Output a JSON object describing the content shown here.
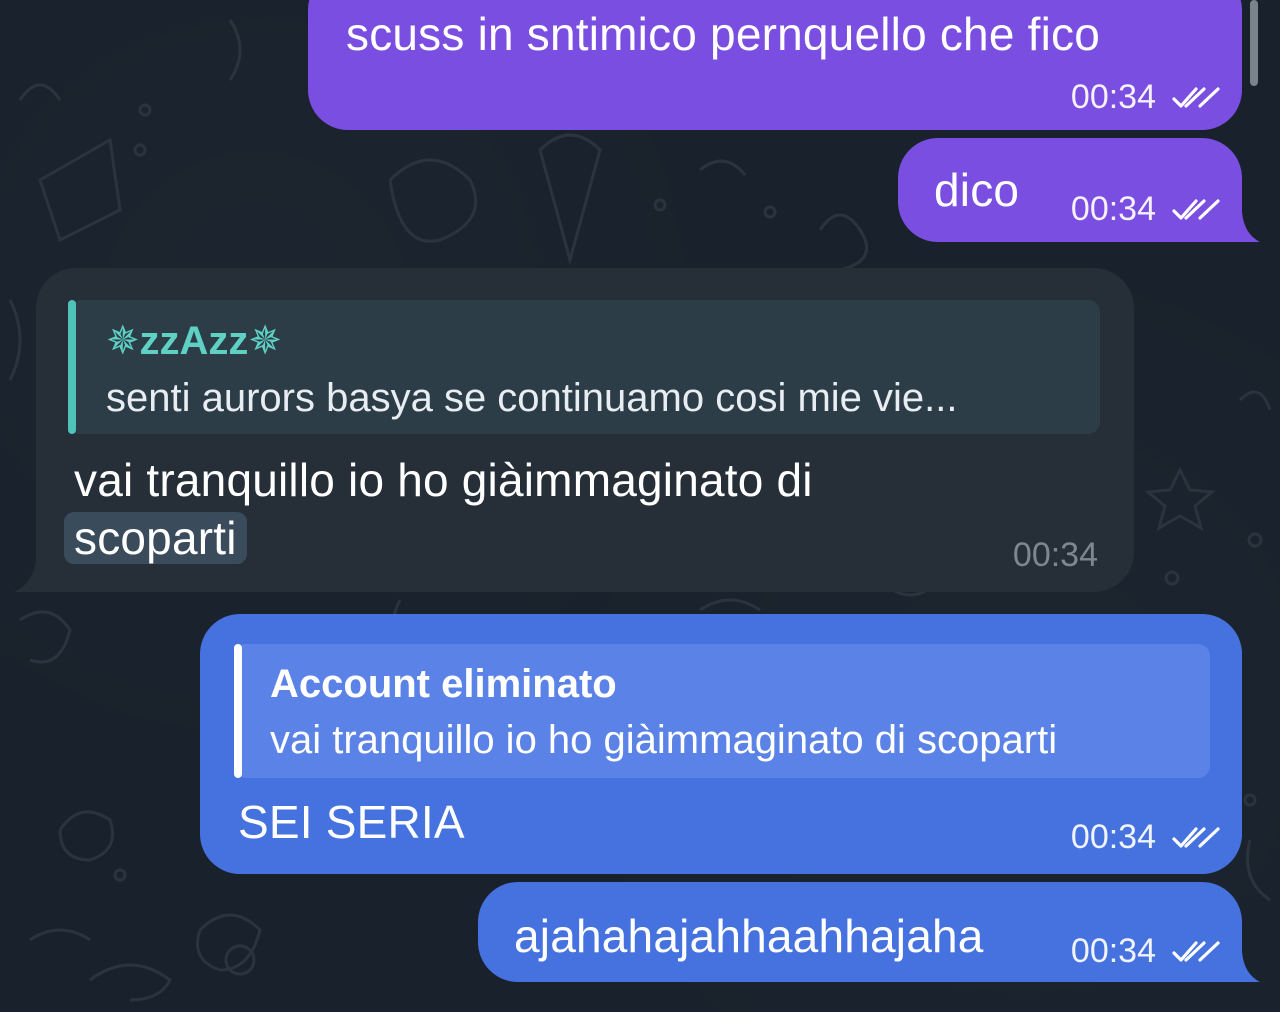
{
  "messages": [
    {
      "text": "scuss in sntimico pernquello che fico",
      "time": "00:34"
    },
    {
      "text": "dico",
      "time": "00:34"
    },
    {
      "reply_name": "✵zzAzz✵",
      "reply_text": "senti aurors basya se continuamo cosi mie vie...",
      "text_line1": "vai tranquillo io ho giàimmaginato di",
      "text_line2": "scoparti",
      "time": "00:34"
    },
    {
      "reply_name": "Account eliminato",
      "reply_text": "vai tranquillo io ho giàimmaginato di scoparti",
      "text": "SEI SERIA",
      "time": "00:34"
    },
    {
      "text": "ajahahajahhaahhajaha",
      "time": "00:34"
    }
  ],
  "colors": {
    "background": "#19222c",
    "outgoing_purple": "#7a4ee0",
    "outgoing_blue": "#4672e0",
    "incoming": "#262f38",
    "reply_accent_incoming": "#4fc3b8",
    "reply_accent_outgoing": "#ffffff"
  },
  "icons": {
    "read_status": "double-check-icon"
  }
}
